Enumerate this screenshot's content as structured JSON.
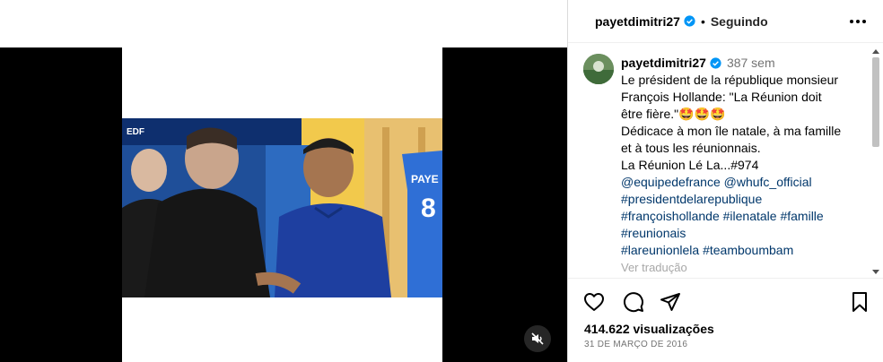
{
  "header": {
    "username": "payetdimitri27",
    "separator": "•",
    "follow_status": "Seguindo",
    "more_icon": "more-horizontal-icon"
  },
  "caption": {
    "username": "payetdimitri27",
    "time_ago": "387 sem",
    "lines": [
      "Le président de la république monsieur",
      "François Hollande: \"La Réunion doit",
      "être fière.\"🤩🤩🤩",
      "Dédicace à mon île natale, à ma famille",
      "et à tous les réunionnais.",
      "La Réunion Lé La...#974"
    ],
    "hashtags": [
      "@equipedefrance @whufc_official",
      "#presidentdelarepublique",
      "#françoishollande #ilenatale #famille",
      "#reunionais",
      "#lareunionlela #teamboumbam"
    ],
    "translate_label": "Ver tradução"
  },
  "video": {
    "jersey_text": "PAYE",
    "jersey_number": "8",
    "banner_text": "EDF"
  },
  "actions": {
    "like_icon": "heart-icon",
    "comment_icon": "comment-icon",
    "share_icon": "share-icon",
    "save_icon": "bookmark-icon"
  },
  "stats": {
    "views": "414.622 visualizações",
    "date": "31 DE MARÇO DE 2016"
  },
  "colors": {
    "verified": "#0095f6",
    "hashtag": "#00376b",
    "muted": "#737373"
  }
}
